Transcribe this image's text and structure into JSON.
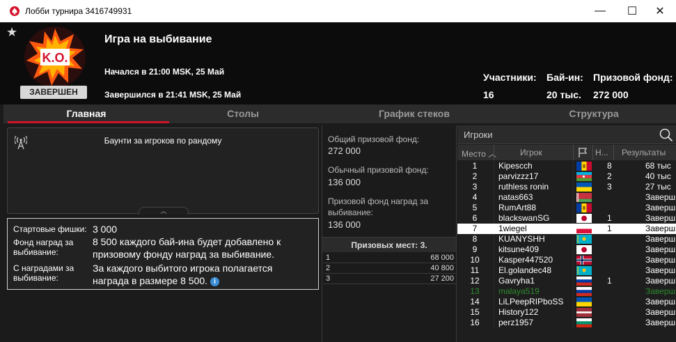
{
  "window": {
    "title": "Лобби турнира 3416749931",
    "minimize_glyph": "—",
    "maximize_glyph": "☐",
    "close_glyph": "✕"
  },
  "header": {
    "logo_text": "K.O.",
    "status": "ЗАВЕРШЕН",
    "game_title": "Игра на выбивание",
    "start_time": "Начался в 21:00 MSK, 25 Май",
    "end_time": "Завершился в 21:41 MSK, 25 Май",
    "stats": [
      {
        "label": "Участники:",
        "value": "16"
      },
      {
        "label": "Бай-ин:",
        "value": "20 тыс."
      },
      {
        "label": "Призовой фонд:",
        "value": "272 000"
      }
    ]
  },
  "tabs": [
    "Главная",
    "Столы",
    "График стеков",
    "Структура"
  ],
  "active_tab": 0,
  "bounty": {
    "description": "Баунти за игроков по рандому",
    "collapse_glyph": "︿"
  },
  "info": {
    "rows": [
      {
        "label": "Стартовые фишки:",
        "value": "3 000"
      },
      {
        "label": "Фонд наград за выбивание:",
        "value": "8 500 каждого бай-ина будет добавлено к призовому фонду наград за выбивание."
      },
      {
        "label": "С наградами за выбивание:",
        "value": "За каждого выбитого игрока полагается награда в размере 8 500."
      }
    ],
    "info_icon": "i"
  },
  "prize": {
    "total_label": "Общий призовой фонд:",
    "total_value": "272 000",
    "regular_label": "Обычный призовой фонд:",
    "regular_value": "136 000",
    "bounty_label": "Призовой фонд наград за выбивание:",
    "bounty_value": "136 000",
    "places_header": "Призовых мест: 3.",
    "places": [
      {
        "place": "1",
        "amount": "68 000"
      },
      {
        "place": "2",
        "amount": "40 800"
      },
      {
        "place": "3",
        "amount": "27 200"
      }
    ]
  },
  "players_panel": {
    "title": "Игроки",
    "columns": {
      "place": "Место",
      "player": "Игрок",
      "n": "Н...",
      "results": "Результаты"
    }
  },
  "players": [
    {
      "place": "1",
      "name": "Kipescch",
      "flag": "moldova",
      "n": "8",
      "result": "68 тыс"
    },
    {
      "place": "2",
      "name": "parvizzz17",
      "flag": "azerbaijan",
      "n": "2",
      "result": "40 тыс"
    },
    {
      "place": "3",
      "name": "ruthless ronin",
      "flag": "ukraine",
      "n": "3",
      "result": "27 тыс"
    },
    {
      "place": "4",
      "name": "natas663",
      "flag": "belarus",
      "n": "",
      "result": "Заверш"
    },
    {
      "place": "5",
      "name": "RumArt88",
      "flag": "moldova",
      "n": "",
      "result": "Заверш"
    },
    {
      "place": "6",
      "name": "blackswanSG",
      "flag": "japan",
      "n": "1",
      "result": "Заверш"
    },
    {
      "place": "7",
      "name": "1wiegel",
      "flag": "poland",
      "n": "1",
      "result": "Заверш"
    },
    {
      "place": "8",
      "name": "KUANYSHH",
      "flag": "kazakhstan",
      "n": "",
      "result": "Заверш"
    },
    {
      "place": "9",
      "name": "kitsune409",
      "flag": "japan",
      "n": "",
      "result": "Заверш"
    },
    {
      "place": "10",
      "name": "Kasper447520",
      "flag": "norway",
      "n": "",
      "result": "Заверш"
    },
    {
      "place": "11",
      "name": "El.golandec48",
      "flag": "kazakhstan",
      "n": "",
      "result": "Заверш"
    },
    {
      "place": "12",
      "name": "Gavryha1",
      "flag": "russia",
      "n": "1",
      "result": "Заверш"
    },
    {
      "place": "13",
      "name": "malaya519",
      "flag": "russia",
      "n": "",
      "result": "Заверш"
    },
    {
      "place": "14",
      "name": "LiLPeepRIPboSS",
      "flag": "ukraine",
      "n": "",
      "result": "Заверш"
    },
    {
      "place": "15",
      "name": "History122",
      "flag": "latvia",
      "n": "",
      "result": "Заверш"
    },
    {
      "place": "16",
      "name": "perz1957",
      "flag": "bulgaria",
      "n": "",
      "result": "Заверш"
    }
  ],
  "selected_player": "1wiegel",
  "highlighted_player": "malaya519",
  "colors": {
    "accent": "#d5122a",
    "background": "#1b1b1b",
    "header": "#0c0c0c",
    "highlight_green": "#2e8b2e",
    "info_blue": "#3b8dd6"
  }
}
